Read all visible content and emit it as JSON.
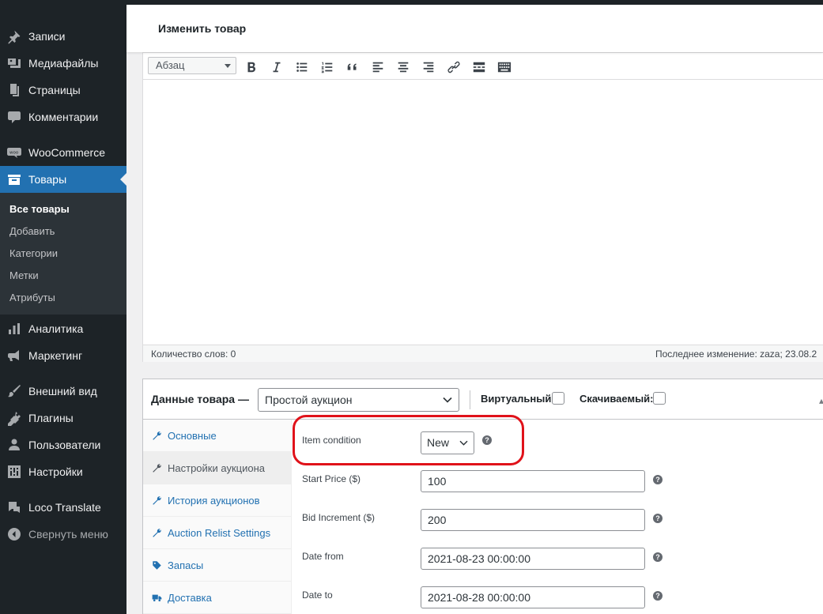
{
  "sidebar": {
    "items": [
      {
        "label": "Записи",
        "icon": "pin-icon"
      },
      {
        "label": "Медиафайлы",
        "icon": "media-icon"
      },
      {
        "label": "Страницы",
        "icon": "pages-icon"
      },
      {
        "label": "Комментарии",
        "icon": "comments-icon"
      },
      {
        "label": "WooCommerce",
        "icon": "woocommerce-icon"
      },
      {
        "label": "Товары",
        "icon": "products-icon"
      },
      {
        "label": "Аналитика",
        "icon": "analytics-icon"
      },
      {
        "label": "Маркетинг",
        "icon": "megaphone-icon"
      },
      {
        "label": "Внешний вид",
        "icon": "brush-icon"
      },
      {
        "label": "Плагины",
        "icon": "plugins-icon"
      },
      {
        "label": "Пользователи",
        "icon": "users-icon"
      },
      {
        "label": "Настройки",
        "icon": "settings-icon"
      },
      {
        "label": "Loco Translate",
        "icon": "translate-icon"
      },
      {
        "label": "Свернуть меню",
        "icon": "collapse-icon"
      }
    ],
    "submenu": [
      "Все товары",
      "Добавить",
      "Категории",
      "Метки",
      "Атрибуты"
    ]
  },
  "header": {
    "title": "Изменить товар"
  },
  "editor": {
    "format": "Абзац",
    "toolbar": [
      "bold-icon",
      "italic-icon",
      "bullet-list-icon",
      "numbered-list-icon",
      "quote-icon",
      "align-left-icon",
      "align-center-icon",
      "align-right-icon",
      "link-icon",
      "read-more-icon",
      "toolbar-toggle-icon"
    ],
    "word_count": "Количество слов: 0",
    "last_edit": "Последнее изменение: zaza; 23.08.2"
  },
  "product_data": {
    "title": "Данные товара —",
    "type": "Простой аукцион",
    "virtual_label": "Виртуальный:",
    "downloadable_label": "Скачиваемый:",
    "tabs": [
      "Основные",
      "Настройки аукциона",
      "История аукционов",
      "Auction Relist Settings",
      "Запасы",
      "Доставка"
    ],
    "fields": {
      "condition_label": "Item condition",
      "condition_value": "New",
      "start_price_label": "Start Price ($)",
      "start_price": "100",
      "bid_increment_label": "Bid Increment ($)",
      "bid_increment": "200",
      "date_from_label": "Date from",
      "date_from": "2021-08-23 00:00:00",
      "date_to_label": "Date to",
      "date_to": "2021-08-28 00:00:00"
    }
  },
  "colors": {
    "sidebar_bg": "#1d2327",
    "active": "#2271b1",
    "highlight": "#e0121a"
  }
}
